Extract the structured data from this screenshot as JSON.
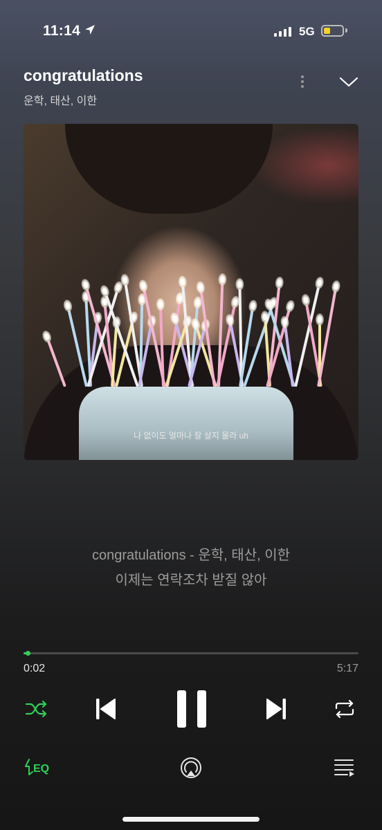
{
  "status_bar": {
    "time": "11:14",
    "network": "5G"
  },
  "song": {
    "title": "congratulations",
    "artist": "운학, 태산, 이한"
  },
  "album_art": {
    "subtitle": "나 없이도 얼마나 잘 살지 몰라 uh"
  },
  "lyrics": {
    "line1": "congratulations - 운학, 태산, 이한",
    "line2": "이제는 연락조차 받질 않아"
  },
  "playback": {
    "elapsed": "0:02",
    "total": "5:17",
    "progress": 0.006
  },
  "colors": {
    "accent": "#2fd158",
    "battery": "#f5d12a"
  },
  "controls": {
    "shuffle": "shuffle-icon",
    "previous": "skip-previous-icon",
    "play_pause": "pause-icon",
    "next": "skip-next-icon",
    "repeat": "repeat-icon",
    "eq": "equalizer-icon",
    "cast": "airplay-icon",
    "queue": "queue-icon"
  }
}
